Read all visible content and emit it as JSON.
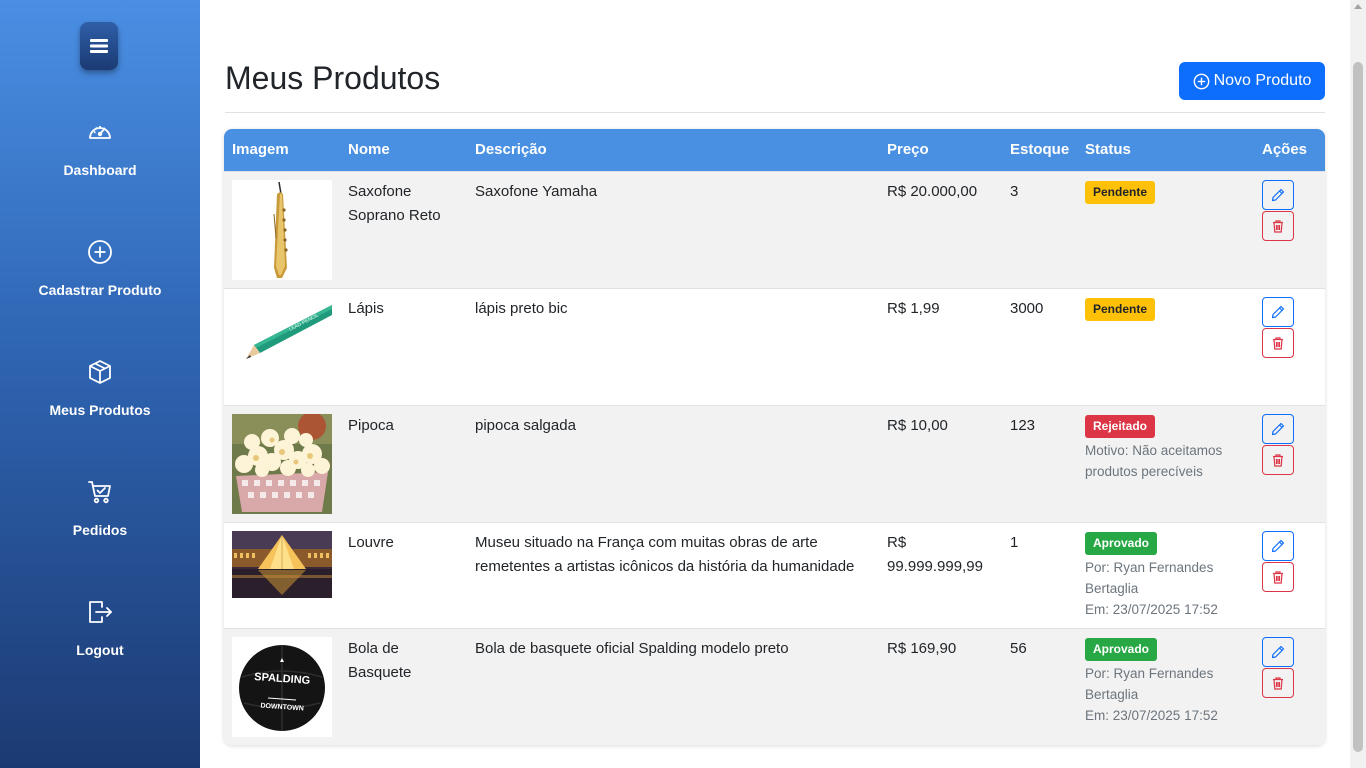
{
  "sidebar": {
    "toggle_icon": "hamburger-icon",
    "items": [
      {
        "label": "Dashboard",
        "icon": "speedometer-icon"
      },
      {
        "label": "Cadastrar Produto",
        "icon": "plus-circle-icon"
      },
      {
        "label": "Meus Produtos",
        "icon": "box-icon"
      },
      {
        "label": "Pedidos",
        "icon": "cart-icon"
      },
      {
        "label": "Logout",
        "icon": "logout-icon"
      }
    ]
  },
  "header": {
    "title": "Meus Produtos",
    "new_button_label": "Novo Produto"
  },
  "table": {
    "columns": [
      "Imagem",
      "Nome",
      "Descrição",
      "Preço",
      "Estoque",
      "Status",
      "Ações"
    ],
    "rows": [
      {
        "image": "saxophone-image",
        "name": "Saxofone Soprano Reto",
        "description": "Saxofone Yamaha",
        "price": "R$ 20.000,00",
        "stock": "3",
        "status": "Pendente",
        "note1": "",
        "note2": "",
        "note3": ""
      },
      {
        "image": "pencil-image",
        "name": "Lápis",
        "description": "lápis preto bic",
        "price": "R$ 1,99",
        "stock": "3000",
        "status": "Pendente",
        "note1": "",
        "note2": "",
        "note3": ""
      },
      {
        "image": "popcorn-image",
        "name": "Pipoca",
        "description": "pipoca salgada",
        "price": "R$ 10,00",
        "stock": "123",
        "status": "Rejeitado",
        "note1": "Motivo: Não aceitamos",
        "note2": "produtos perecíveis",
        "note3": ""
      },
      {
        "image": "louvre-image",
        "name": "Louvre",
        "description": "Museu situado na França com muitas obras de arte remetentes a artistas icônicos da história da humanidade",
        "price": "R$ 99.999.999,99",
        "stock": "1",
        "status": "Aprovado",
        "note1": "Por: Ryan Fernandes",
        "note2": "Bertaglia",
        "note3": "Em: 23/07/2025 17:52"
      },
      {
        "image": "basketball-image",
        "name": "Bola de Basquete",
        "description": "Bola de basquete oficial Spalding modelo preto",
        "price": "R$ 169,90",
        "stock": "56",
        "status": "Aprovado",
        "note1": "Por: Ryan Fernandes",
        "note2": "Bertaglia",
        "note3": "Em: 23/07/2025 17:52",
        "ball_brand": "SPALDING",
        "ball_model": "DOWNTOWN"
      }
    ]
  },
  "colors": {
    "primary": "#0d6efd",
    "table_header": "#4a90e2",
    "pending": "#ffc107",
    "rejected": "#dc3545",
    "approved": "#28a745"
  }
}
